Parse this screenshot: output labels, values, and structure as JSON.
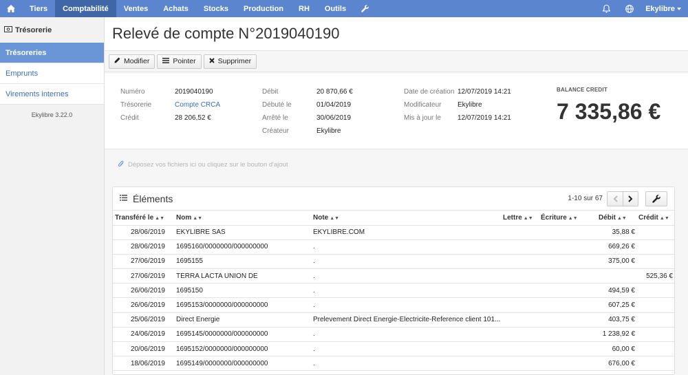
{
  "nav": {
    "items": [
      {
        "label": "Tiers"
      },
      {
        "label": "Comptabilité"
      },
      {
        "label": "Ventes"
      },
      {
        "label": "Achats"
      },
      {
        "label": "Stocks"
      },
      {
        "label": "Production"
      },
      {
        "label": "RH"
      },
      {
        "label": "Outils"
      }
    ],
    "active": "Comptabilité",
    "user": "Ekylibre",
    "icons": [
      "home-icon",
      "wrench-icon",
      "bell-icon",
      "globe-icon"
    ]
  },
  "sidebar": {
    "section": "Trésorerie",
    "items": [
      {
        "label": "Trésoreries"
      },
      {
        "label": "Emprunts"
      },
      {
        "label": "Virements internes"
      }
    ],
    "version": "Ekylibre 3.22.0"
  },
  "page": {
    "title": "Relevé de compte N°2019040190"
  },
  "toolbar": {
    "modify": "Modifier",
    "check": "Pointer",
    "delete": "Supprimer"
  },
  "info": {
    "col1": [
      {
        "label": "Numéro",
        "value": "2019040190"
      },
      {
        "label": "Trésorerie",
        "value": "Compte CRCA"
      },
      {
        "label": "Crédit",
        "value": "28 206,52 €"
      }
    ],
    "col2": [
      {
        "label": "Débit",
        "value": "20 870,66 €"
      },
      {
        "label": "Débuté le",
        "value": "01/04/2019"
      },
      {
        "label": "Arrêté le",
        "value": "30/06/2019"
      },
      {
        "label": "Créateur",
        "value": "Ekylibre"
      }
    ],
    "col3": [
      {
        "label": "Date de création",
        "value": "12/07/2019 14:21"
      },
      {
        "label": "Modificateur",
        "value": "Ekylibre"
      },
      {
        "label": "Mis à jour le",
        "value": "12/07/2019 14:21"
      }
    ],
    "balance_label": "BALANCE CREDIT",
    "balance_value": "7 335,86 €"
  },
  "dropzone": "Déposez vos fichiers ici ou cliquez sur le bouton d'ajout",
  "elements": {
    "title": "Éléments",
    "pagination": "1-10 sur 67",
    "columns": [
      "Transféré le",
      "Nom",
      "Note",
      "Lettre",
      "Écriture",
      "Débit",
      "Crédit"
    ],
    "rows": [
      {
        "date": "28/06/2019",
        "name": "EKYLIBRE SAS",
        "note": "EKYLIBRE.COM",
        "letter": "",
        "entry": "",
        "debit": "35,88 €",
        "credit": ""
      },
      {
        "date": "28/06/2019",
        "name": "1695160/0000000/000000000",
        "note": ".",
        "letter": "",
        "entry": "",
        "debit": "669,26 €",
        "credit": ""
      },
      {
        "date": "27/06/2019",
        "name": "1695155",
        "note": ".",
        "letter": "",
        "entry": "",
        "debit": "375,00 €",
        "credit": ""
      },
      {
        "date": "27/06/2019",
        "name": "TERRA LACTA UNION DE",
        "note": ".",
        "letter": "",
        "entry": "",
        "debit": "",
        "credit": "525,36 €"
      },
      {
        "date": "26/06/2019",
        "name": "1695150",
        "note": ".",
        "letter": "",
        "entry": "",
        "debit": "494,59 €",
        "credit": ""
      },
      {
        "date": "26/06/2019",
        "name": "1695153/0000000/000000000",
        "note": ".",
        "letter": "",
        "entry": "",
        "debit": "607,25 €",
        "credit": ""
      },
      {
        "date": "25/06/2019",
        "name": "Direct Energie",
        "note": "Prelevement Direct Energie-Electricite-Reference client 101...",
        "letter": "",
        "entry": "",
        "debit": "403,75 €",
        "credit": ""
      },
      {
        "date": "24/06/2019",
        "name": "1695145/0000000/000000000",
        "note": ".",
        "letter": "",
        "entry": "",
        "debit": "1 238,92 €",
        "credit": ""
      },
      {
        "date": "20/06/2019",
        "name": "1695152/0000000/000000000",
        "note": ".",
        "letter": "",
        "entry": "",
        "debit": "60,00 €",
        "credit": ""
      },
      {
        "date": "18/06/2019",
        "name": "1695149/0000000/000000000",
        "note": ".",
        "letter": "",
        "entry": "",
        "debit": "676,00 €",
        "credit": ""
      }
    ]
  }
}
